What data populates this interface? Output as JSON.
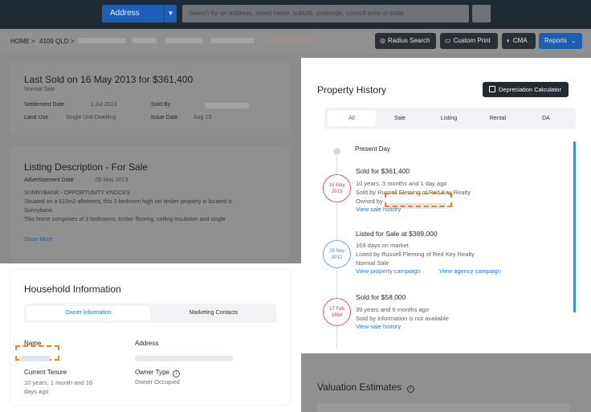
{
  "topbar": {
    "search_type": "Address",
    "search_placeholder": "Search for an address, street name, suburb, postcode, council area or state"
  },
  "breadcrumb": {
    "home": "HOME",
    "sep": ">",
    "state": "4109 QLD"
  },
  "toolbar": {
    "radius_search": "Radius Search",
    "custom_print": "Custom Print",
    "cma": "CMA",
    "reports": "Reports"
  },
  "last_sold": {
    "title": "Last Sold on 16 May 2013 for $361,400",
    "subtitle": "Normal Sale",
    "settlement_label": "Settlement Date",
    "settlement_value": "1 Jul 2013",
    "sold_by_label": "Sold By",
    "land_use_label": "Land Use",
    "land_use_value": "Single Unit Dwelling",
    "issue_label": "Issue Date",
    "issue_value": "Aug 13"
  },
  "listing": {
    "title": "Listing Description - For Sale",
    "ad_label": "Advertisement Date",
    "ad_value": "05 May 2013",
    "line1": "SUNNYBANK - OPPORTUNITY KNOCKS",
    "line2": "Situated on a 615m2 allotment, this 3 bedroom high set timber property is located in",
    "line3": "Sunnybank.",
    "line4": "This home comprises of 3 bedrooms, timber flooring, ceiling insulation and single",
    "show_more": "Show More"
  },
  "household": {
    "title": "Household Information",
    "tab_owner": "Owner Information",
    "tab_marketing": "Marketing Contacts",
    "name_label": "Name",
    "address_label": "Address",
    "tenure_label": "Current Tenure",
    "tenure_value": "10 years, 1 month and 16 days ago",
    "owner_type_label": "Owner Type",
    "owner_type_value": "Owner Occupied"
  },
  "history": {
    "title": "Property History",
    "depreciation_btn": "Depreciation Calculator",
    "tabs": [
      "All",
      "Sale",
      "Listing",
      "Rental",
      "DA"
    ],
    "present": "Present Day",
    "events": [
      {
        "date_day": "16 May",
        "date_year": "2013",
        "title": "Sold for $361,400",
        "line1": "10 years, 3 months and 1 day ago",
        "line2": "Sold by Russell Fleming of Red Key Realty",
        "line3": "Owned by",
        "link1": "View sale history"
      },
      {
        "date_day": "29 Nov",
        "date_year": "2012",
        "title": "Listed for Sale at $389,000",
        "line1": "169 days on market",
        "line2": "Listed by Russell Fleming of Red Key Realty",
        "line3": "Normal Sale",
        "link1": "View property campaign",
        "link2": "View agency campaign"
      },
      {
        "date_day": "17 Feb",
        "date_year": "1984",
        "title": "Sold for $58,000",
        "line1": "39 years and 6 months ago",
        "line2": "Sold by information is not available",
        "link1": "View sale history"
      }
    ]
  },
  "valuation": {
    "title": "Valuation Estimates"
  },
  "colors": {
    "accent_blue": "#2a78d8",
    "brand_blue": "#1e5fb0",
    "highlight_orange": "#f08018",
    "date_red": "#d84545"
  }
}
